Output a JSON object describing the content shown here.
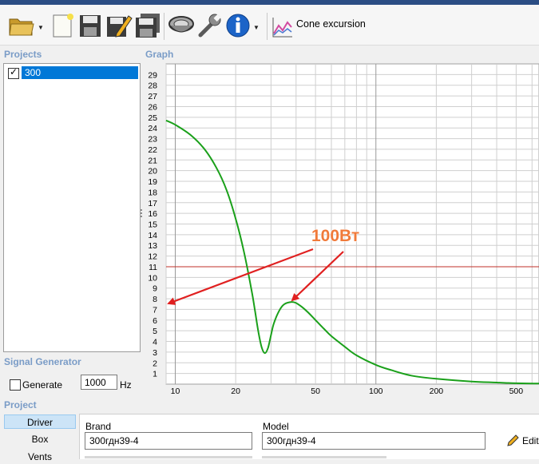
{
  "toolbar": {
    "items": [
      {
        "name": "open-folder-icon",
        "dropdown": true
      },
      {
        "name": "new-file-icon"
      },
      {
        "name": "save-icon"
      },
      {
        "name": "save-as-edit-icon"
      },
      {
        "name": "save-all-icon"
      },
      {
        "name": "speaker-driver-icon"
      },
      {
        "name": "wrench-icon"
      },
      {
        "name": "info-icon",
        "dropdown": true
      },
      {
        "name": "cone-excursion-chart-icon"
      }
    ],
    "graph_mode_label": "Cone excursion"
  },
  "projects": {
    "section_label": "Projects",
    "items": [
      {
        "label": "300",
        "checked": true,
        "selected": true
      }
    ]
  },
  "graph": {
    "section_label": "Graph",
    "annotation": "100Вт"
  },
  "chart_data": {
    "type": "line",
    "title": "",
    "xlabel": "",
    "ylabel": "",
    "x_scale": "log",
    "xlim": [
      9,
      650
    ],
    "ylim": [
      0,
      30
    ],
    "x_ticks": [
      10,
      20,
      50,
      100,
      200,
      500
    ],
    "y_ticks": [
      1,
      2,
      3,
      4,
      5,
      6,
      7,
      8,
      9,
      10,
      11,
      12,
      13,
      14,
      15,
      16,
      17,
      18,
      19,
      20,
      21,
      22,
      23,
      24,
      25,
      26,
      27,
      28,
      29
    ],
    "grid": true,
    "series": [
      {
        "color": "#1aa01a",
        "x": [
          9,
          10,
          12,
          14,
          16,
          18,
          20,
          22,
          24,
          25,
          26,
          27,
          28,
          29,
          30,
          31,
          33,
          35,
          38,
          40,
          43,
          46,
          50,
          55,
          60,
          70,
          80,
          100,
          120,
          150,
          200,
          300,
          400,
          500,
          650
        ],
        "y": [
          24.7,
          24.3,
          23.3,
          22.0,
          20.3,
          18.2,
          15.5,
          12.4,
          8.8,
          6.8,
          4.8,
          3.4,
          2.9,
          3.4,
          4.6,
          5.7,
          6.9,
          7.5,
          7.7,
          7.6,
          7.2,
          6.7,
          6.0,
          5.2,
          4.5,
          3.5,
          2.7,
          1.8,
          1.3,
          0.8,
          0.5,
          0.25,
          0.15,
          0.08,
          0.05
        ]
      }
    ],
    "reference_line": {
      "y": 11,
      "color": "#c0302a"
    }
  },
  "signal_generator": {
    "section_label": "Signal Generator",
    "generate_label": "Generate",
    "generate_checked": false,
    "frequency_value": "1000",
    "unit": "Hz"
  },
  "project": {
    "section_label": "Project",
    "tabs": [
      {
        "label": "Driver",
        "active": true
      },
      {
        "label": "Box",
        "active": false
      },
      {
        "label": "Vents",
        "active": false
      }
    ],
    "brand_label": "Brand",
    "brand_value": "300гдн39-4",
    "model_label": "Model",
    "model_value": "300гдн39-4",
    "edit_label": "Edit"
  },
  "colors": {
    "accent": "#0078d7",
    "section_label": "#7a9cc7",
    "curve": "#1aa01a",
    "reference_line": "#c0302a",
    "arrows": "#e02020",
    "annotation": "#f07a3a"
  }
}
